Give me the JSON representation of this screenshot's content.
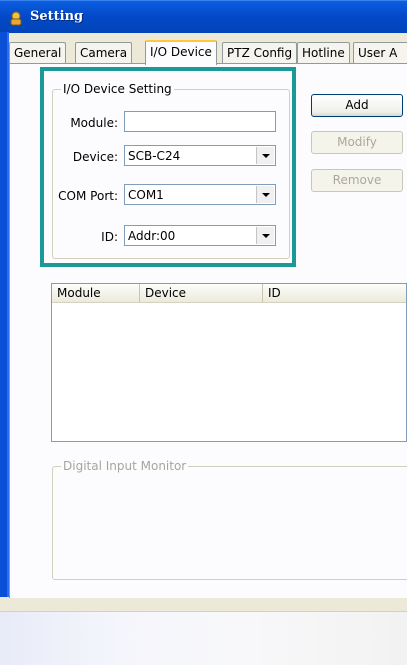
{
  "window": {
    "title": "Setting"
  },
  "tabs": [
    "General",
    "Camera",
    "I/O Device",
    "PTZ Config",
    "Hotline",
    "User A"
  ],
  "active_tab": "I/O Device",
  "io_device_setting": {
    "group_label": "I/O Device Setting",
    "module_label": "Module:",
    "module_value": "",
    "device_label": "Device:",
    "device_value": "SCB-C24",
    "com_port_label": "COM Port:",
    "com_port_value": "COM1",
    "id_label": "ID:",
    "id_value": "Addr:00"
  },
  "buttons": {
    "add": "Add",
    "modify": "Modify",
    "remove": "Remove"
  },
  "device_list": {
    "columns": [
      "Module",
      "Device",
      "ID"
    ],
    "rows": []
  },
  "digital_input_monitor": {
    "label": "Digital Input Monitor"
  },
  "colors": {
    "highlight": "#199a96",
    "titlebar": "#0348c8"
  }
}
